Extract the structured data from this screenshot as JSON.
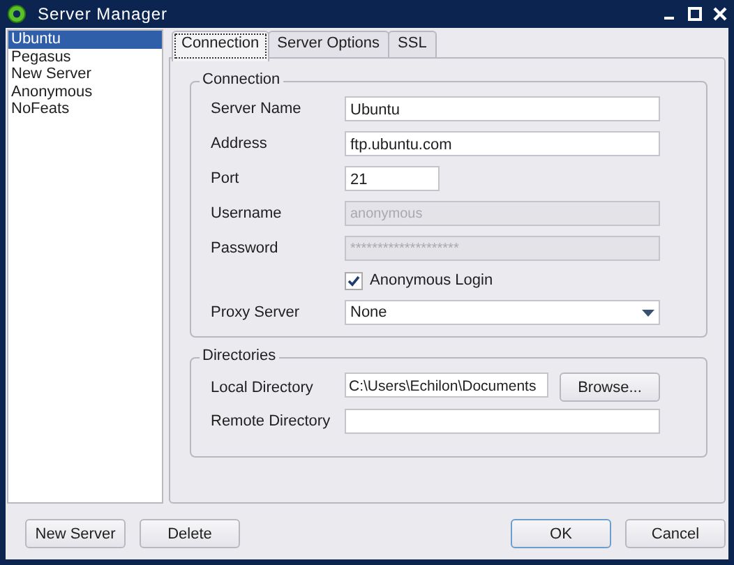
{
  "window": {
    "title": "Server Manager"
  },
  "servers": [
    {
      "label": "Ubuntu",
      "selected": true
    },
    {
      "label": "Pegasus",
      "selected": false
    },
    {
      "label": "New Server",
      "selected": false
    },
    {
      "label": "Anonymous",
      "selected": false
    },
    {
      "label": "NoFeats",
      "selected": false
    }
  ],
  "tabs": [
    {
      "label": "Connection",
      "selected": true
    },
    {
      "label": "Server Options",
      "selected": false
    },
    {
      "label": "SSL",
      "selected": false
    }
  ],
  "connection": {
    "title": "Connection",
    "fields": [
      {
        "kind": "text",
        "label": "Server Name",
        "value": "Ubuntu",
        "disabled": false
      },
      {
        "kind": "text",
        "label": "Address",
        "value": "ftp.ubuntu.com",
        "disabled": false
      },
      {
        "kind": "number",
        "label": "Port",
        "value": "21",
        "disabled": false
      },
      {
        "kind": "text",
        "label": "Username",
        "value": "anonymous",
        "disabled": true
      },
      {
        "kind": "text",
        "label": "Password",
        "value": "********************",
        "disabled": true
      },
      {
        "kind": "checkbox",
        "label": "Anonymous Login",
        "checked": true
      },
      {
        "kind": "dropdown",
        "label": "Proxy Server",
        "value": "None"
      }
    ]
  },
  "directories": {
    "title": "Directories",
    "local": {
      "label": "Local Directory",
      "value": "C:\\Users\\Echilon\\Documents",
      "button": "Browse..."
    },
    "remote": {
      "label": "Remote Directory"
    }
  },
  "buttons": {
    "left": [
      "New Server",
      "Delete"
    ],
    "right": [
      "OK",
      "Cancel"
    ]
  }
}
